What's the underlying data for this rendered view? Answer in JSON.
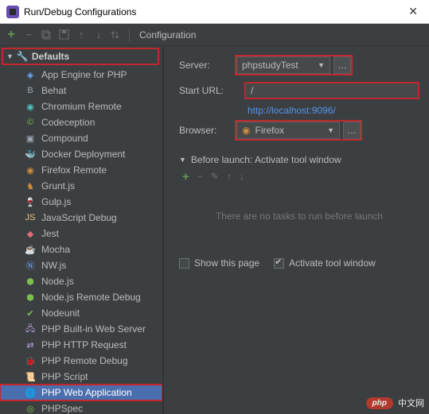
{
  "window": {
    "title": "Run/Debug Configurations"
  },
  "toolbar": {
    "configuration_label": "Configuration"
  },
  "defaults": {
    "label": "Defaults"
  },
  "tree": {
    "items": [
      {
        "label": "App Engine for PHP"
      },
      {
        "label": "Behat"
      },
      {
        "label": "Chromium Remote"
      },
      {
        "label": "Codeception"
      },
      {
        "label": "Compound"
      },
      {
        "label": "Docker Deployment"
      },
      {
        "label": "Firefox Remote"
      },
      {
        "label": "Grunt.js"
      },
      {
        "label": "Gulp.js"
      },
      {
        "label": "JavaScript Debug"
      },
      {
        "label": "Jest"
      },
      {
        "label": "Mocha"
      },
      {
        "label": "NW.js"
      },
      {
        "label": "Node.js"
      },
      {
        "label": "Node.js Remote Debug"
      },
      {
        "label": "Nodeunit"
      },
      {
        "label": "PHP Built-in Web Server"
      },
      {
        "label": "PHP HTTP Request"
      },
      {
        "label": "PHP Remote Debug"
      },
      {
        "label": "PHP Script"
      },
      {
        "label": "PHP Web Application"
      },
      {
        "label": "PHPSpec"
      }
    ],
    "selected_index": 20
  },
  "form": {
    "server_label": "Server:",
    "server_value": "phpstudyTest",
    "start_url_label": "Start URL:",
    "start_url_value": "/",
    "resolved_url": "http://localhost:9096/",
    "browser_label": "Browser:",
    "browser_value": "Firefox"
  },
  "before_launch": {
    "header": "Before launch: Activate tool window",
    "empty_text": "There are no tasks to run before launch",
    "show_this_page": "Show this page",
    "activate_tool_window": "Activate tool window",
    "show_checked": false,
    "activate_checked": true
  },
  "watermark": {
    "bubble": "php",
    "text": "中文网"
  }
}
